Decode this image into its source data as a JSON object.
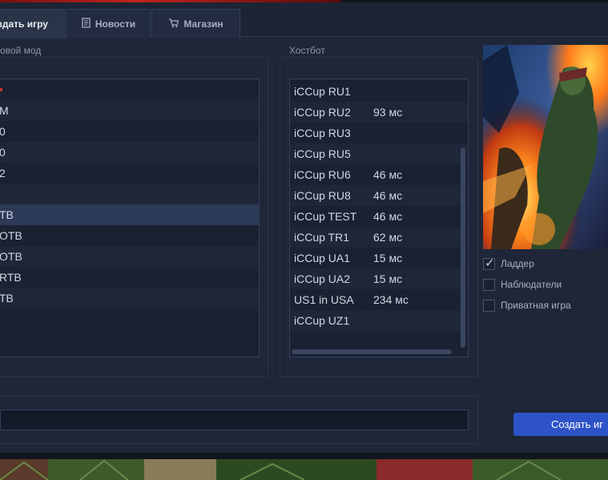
{
  "tabs": [
    {
      "label": "Создать игру",
      "icon": "create-game-icon",
      "active": true
    },
    {
      "label": "Новости",
      "icon": "news-icon",
      "active": false
    },
    {
      "label": "Магазин",
      "icon": "cart-icon",
      "active": false
    }
  ],
  "game_mode": {
    "label": "овой мод",
    "items": [
      "",
      "M",
      "0",
      "0",
      "2",
      "",
      "TB",
      "OTB",
      "OTB",
      "RTB",
      "TB"
    ],
    "selected_index": 6
  },
  "hostbot": {
    "label": "Хостбот",
    "items": [
      {
        "name": "iCCup RU1",
        "ping": ""
      },
      {
        "name": "iCCup RU2",
        "ping": "93 мс"
      },
      {
        "name": "iCCup RU3",
        "ping": ""
      },
      {
        "name": "iCCup RU5",
        "ping": ""
      },
      {
        "name": "iCCup RU6",
        "ping": "46 мс"
      },
      {
        "name": "iCCup RU8",
        "ping": "46 мс"
      },
      {
        "name": "iCCup TEST",
        "ping": "46 мс"
      },
      {
        "name": "iCCup TR1",
        "ping": "62 мс"
      },
      {
        "name": "iCCup UA1",
        "ping": "15 мс"
      },
      {
        "name": "iCCup UA2",
        "ping": "15 мс"
      },
      {
        "name": "US1 in USA",
        "ping": "234 мс"
      },
      {
        "name": "iCCup UZ1",
        "ping": ""
      }
    ]
  },
  "options": {
    "ladder": {
      "label": "Ладдер",
      "checked": true
    },
    "observers": {
      "label": "Наблюдатели",
      "checked": false
    },
    "private": {
      "label": "Приватная игра",
      "checked": false
    }
  },
  "game_name_input": {
    "value": ""
  },
  "create_button": {
    "label": "Создать иг"
  },
  "colors": {
    "background": "#1e2638",
    "selected_row": "#2c3a58",
    "accent_button": "#2e53c8",
    "mode_first_item_marker": "#c0392b"
  }
}
